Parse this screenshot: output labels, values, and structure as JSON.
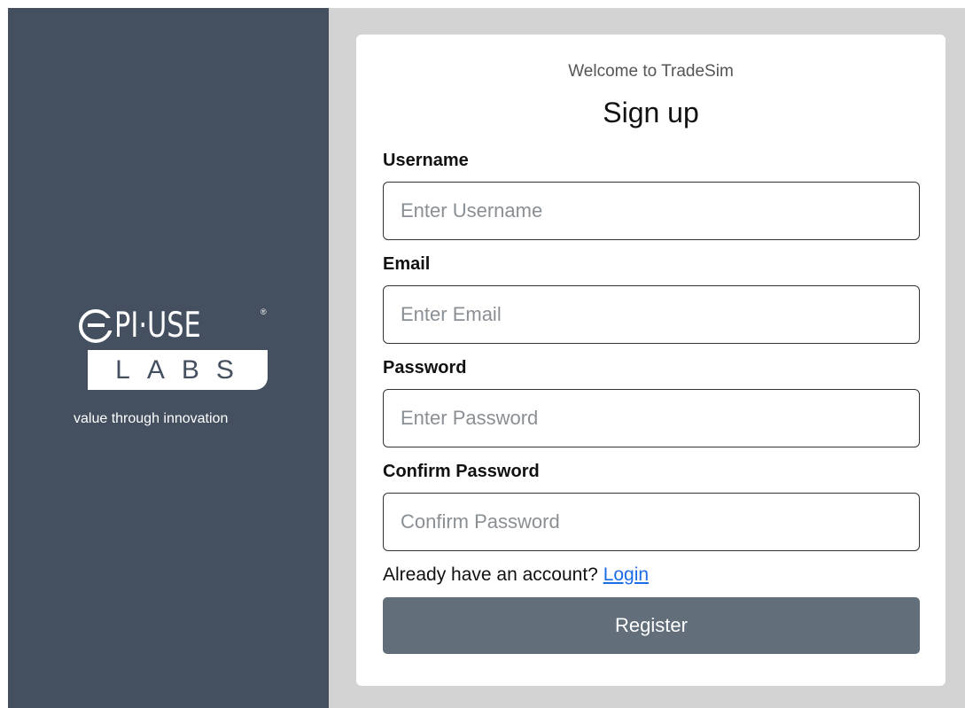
{
  "brand": {
    "logo_text": "PI·USE",
    "logo_registered": "®",
    "logo_sub": "LABS",
    "tagline": "value through innovation"
  },
  "form": {
    "welcome": "Welcome to TradeSim",
    "title": "Sign up",
    "username_label": "Username",
    "username_placeholder": "Enter Username",
    "username_value": "",
    "email_label": "Email",
    "email_placeholder": "Enter Email",
    "email_value": "",
    "password_label": "Password",
    "password_placeholder": "Enter Password",
    "password_value": "",
    "confirm_label": "Confirm Password",
    "confirm_placeholder": "Confirm Password",
    "confirm_value": "",
    "account_prompt": "Already have an account?",
    "login_link": "Login",
    "register_button": "Register"
  },
  "colors": {
    "sidebar": "#44505f",
    "background": "#d3d3d3",
    "card": "#ffffff",
    "button": "#626e7a",
    "link": "#1e6be6"
  }
}
